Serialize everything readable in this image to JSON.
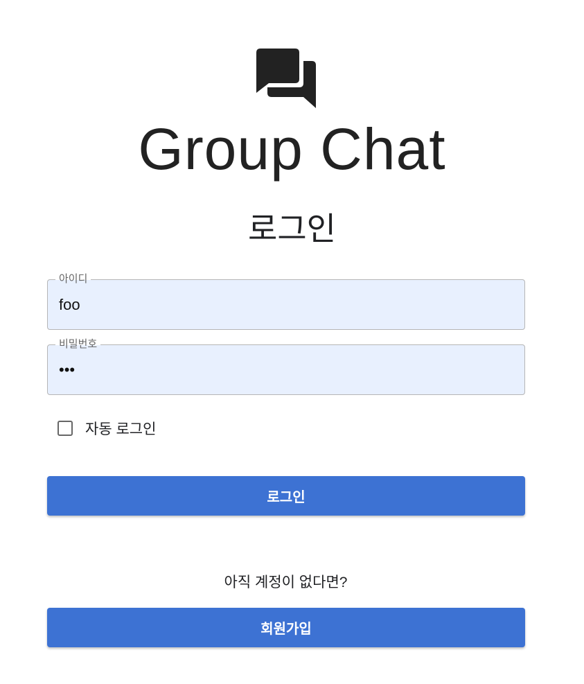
{
  "app": {
    "title": "Group Chat",
    "logo_icon": "forum-icon"
  },
  "login": {
    "heading": "로그인",
    "id_field": {
      "label": "아이디",
      "value": "foo"
    },
    "password_field": {
      "label": "비밀번호",
      "value": "***"
    },
    "auto_login": {
      "label": "자동 로그인",
      "checked": false
    },
    "submit_label": "로그인"
  },
  "signup": {
    "prompt": "아직 계정이 없다면?",
    "button_label": "회원가입"
  },
  "colors": {
    "primary": "#3d72d3",
    "field_background": "#e8f0fe"
  }
}
